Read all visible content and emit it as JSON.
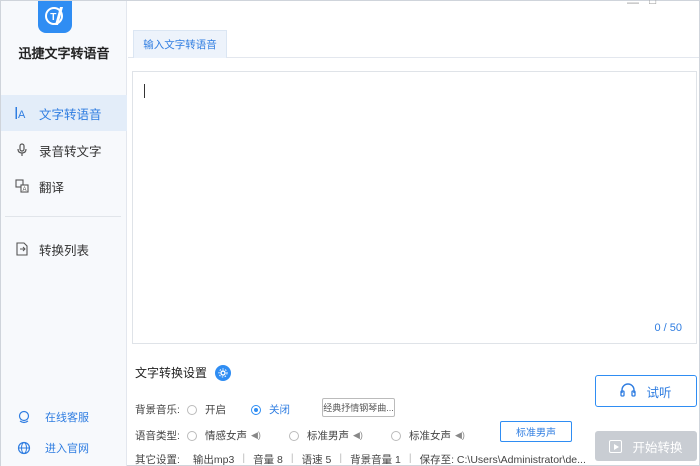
{
  "sidebar": {
    "app_title": "迅捷文字转语音",
    "items": [
      {
        "label": "文字转语音",
        "icon": "text-icon",
        "active": true
      },
      {
        "label": "录音转文字",
        "icon": "microphone-icon",
        "active": false
      },
      {
        "label": "翻译",
        "icon": "translate-icon",
        "active": false
      },
      {
        "label": "转换列表",
        "icon": "list-icon",
        "active": false
      }
    ],
    "footer": [
      {
        "label": "在线客服",
        "icon": "headset-icon"
      },
      {
        "label": "进入官网",
        "icon": "globe-icon"
      }
    ]
  },
  "tabs": [
    {
      "label": "输入文字转语音"
    }
  ],
  "editor": {
    "counter": "0 / 50"
  },
  "settings": {
    "title": "文字转换设置",
    "bg_music": {
      "label": "背景音乐:",
      "on": "开启",
      "off": "关闭",
      "selected": "关闭",
      "track": "经典抒情钢琴曲..."
    },
    "voice_type": {
      "label": "语音类型:",
      "options": [
        "情感女声",
        "标准男声",
        "标准女声"
      ],
      "button": "标准男声"
    },
    "other": {
      "label": "其它设置:",
      "items": [
        "输出mp3",
        "音量 8",
        "语速 5",
        "背景音量 1",
        "保存至: C:\\Users\\Administrator\\de..."
      ]
    }
  },
  "buttons": {
    "listen": "试听",
    "start": "开始转换"
  },
  "colors": {
    "accent": "#2f8df3",
    "active_bg": "#e3edf9",
    "disabled": "#c9cdd3"
  }
}
